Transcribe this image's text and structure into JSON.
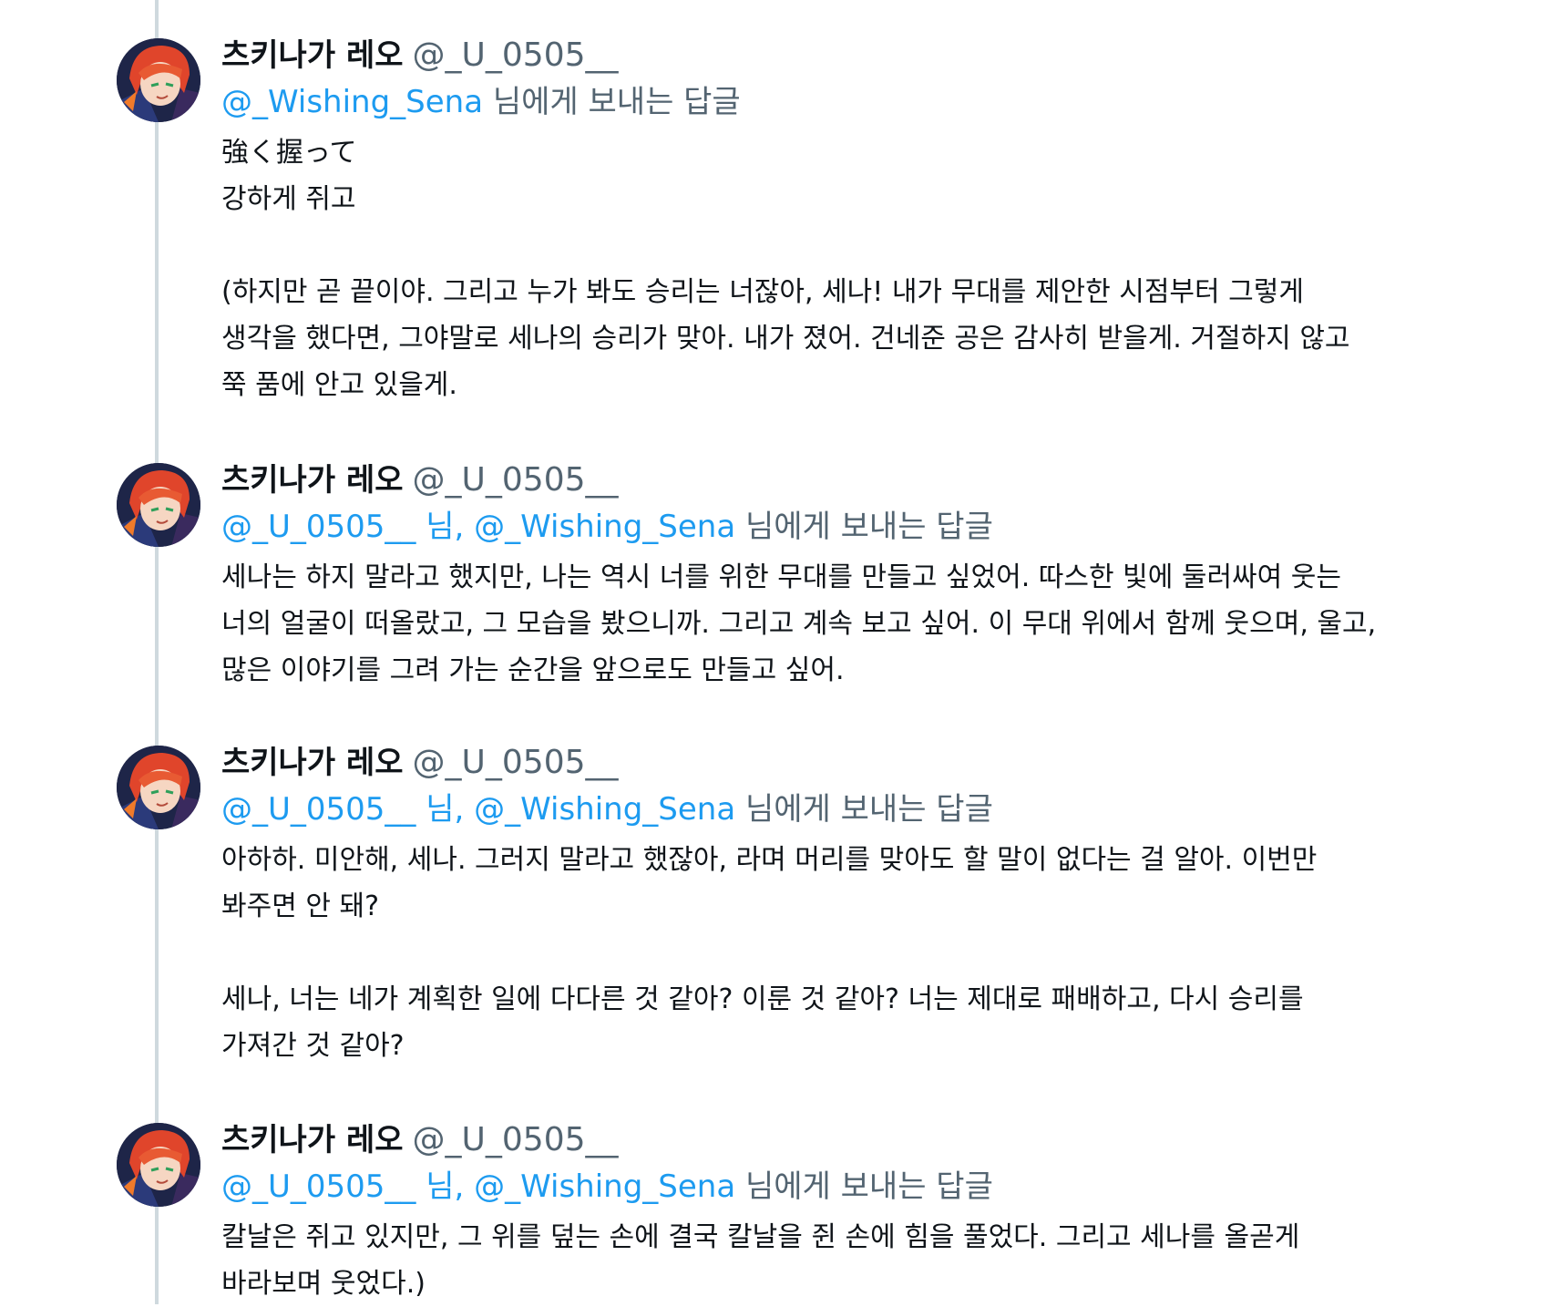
{
  "tweets": [
    {
      "display_name": "츠키나가 레오",
      "handle": "@_U_0505__",
      "reply_to": [
        "@_Wishing_Sena"
      ],
      "reply_suffix": "님에게 보내는 답글",
      "reply_sep": "님, ",
      "text": "強く握って\n강하게 쥐고\n\n(하지만 곧 끝이야. 그리고 누가 봐도 승리는 너잖아, 세나! 내가 무대를 제안한 시점부터 그렇게\n생각을 했다면, 그야말로 세나의 승리가 맞아. 내가 졌어. 건네준 공은 감사히 받을게. 거절하지 않고\n쭉 품에 안고 있을게."
    },
    {
      "display_name": "츠키나가 레오",
      "handle": "@_U_0505__",
      "reply_to": [
        "@_U_0505__",
        "@_Wishing_Sena"
      ],
      "reply_suffix": "님에게 보내는 답글",
      "reply_sep": "님, ",
      "text": "세나는 하지 말라고 했지만, 나는 역시 너를 위한 무대를 만들고 싶었어. 따스한 빛에 둘러싸여 웃는\n너의 얼굴이 떠올랐고, 그 모습을 봤으니까. 그리고 계속 보고 싶어. 이 무대 위에서 함께 웃으며, 울고,\n많은 이야기를 그려 가는 순간을 앞으로도 만들고 싶어."
    },
    {
      "display_name": "츠키나가 레오",
      "handle": "@_U_0505__",
      "reply_to": [
        "@_U_0505__",
        "@_Wishing_Sena"
      ],
      "reply_suffix": "님에게 보내는 답글",
      "reply_sep": "님, ",
      "text": "아하하. 미안해, 세나. 그러지 말라고 했잖아, 라며 머리를 맞아도 할 말이 없다는 걸 알아. 이번만\n봐주면 안 돼?\n\n세나, 너는 네가 계획한 일에 다다른 것 같아? 이룬 것 같아? 너는 제대로 패배하고, 다시 승리를\n가져간 것 같아?"
    },
    {
      "display_name": "츠키나가 레오",
      "handle": "@_U_0505__",
      "reply_to": [
        "@_U_0505__",
        "@_Wishing_Sena"
      ],
      "reply_suffix": "님에게 보내는 답글",
      "reply_sep": "님, ",
      "text": "칼날은 쥐고 있지만, 그 위를 덮는 손에 결국 칼날을 쥔 손에 힘을 풀었다. 그리고 세나를 올곧게\n바라보며 웃었다.)"
    }
  ],
  "colors": {
    "link": "#1d9bf0",
    "secondary": "#536471",
    "thread_line": "#cfd9de"
  },
  "icons": {
    "avatar": "avatar-image"
  }
}
